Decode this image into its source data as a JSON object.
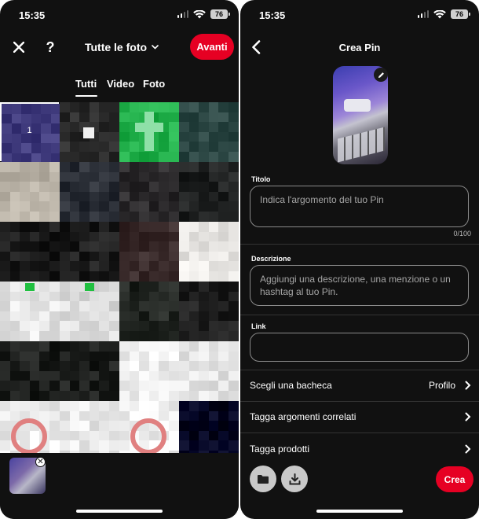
{
  "left": {
    "status": {
      "time": "15:35",
      "battery": "76"
    },
    "header": {
      "album": "Tutte le foto",
      "next_label": "Avanti",
      "help_symbol": "?"
    },
    "tabs": [
      {
        "label": "Tutti",
        "active": true
      },
      {
        "label": "Video",
        "active": false
      },
      {
        "label": "Foto",
        "active": false
      }
    ],
    "grid": {
      "selected_index": "1"
    },
    "icons": [
      "close-icon",
      "help-icon",
      "chevron-down-icon",
      "remove-icon"
    ]
  },
  "right": {
    "status": {
      "time": "15:35",
      "battery": "76"
    },
    "header": {
      "title": "Crea Pin"
    },
    "form": {
      "title_label": "Titolo",
      "title_placeholder": "Indica l'argomento del tuo Pin",
      "title_counter": "0/100",
      "description_label": "Descrizione",
      "description_placeholder": "Aggiungi una descrizione, una menzione o un hashtag al tuo Pin.",
      "link_label": "Link",
      "link_value": ""
    },
    "rows": [
      {
        "label": "Scegli una bacheca",
        "value": "Profilo"
      },
      {
        "label": "Tagga argomenti correlati",
        "value": ""
      },
      {
        "label": "Tagga prodotti",
        "value": ""
      }
    ],
    "create_label": "Crea",
    "icons": [
      "back-icon",
      "pencil-icon",
      "folder-icon",
      "download-icon",
      "chevron-right-icon"
    ]
  },
  "colors": {
    "accent": "#e60023",
    "background": "#111111",
    "muted_text": "#a5a5a5"
  }
}
